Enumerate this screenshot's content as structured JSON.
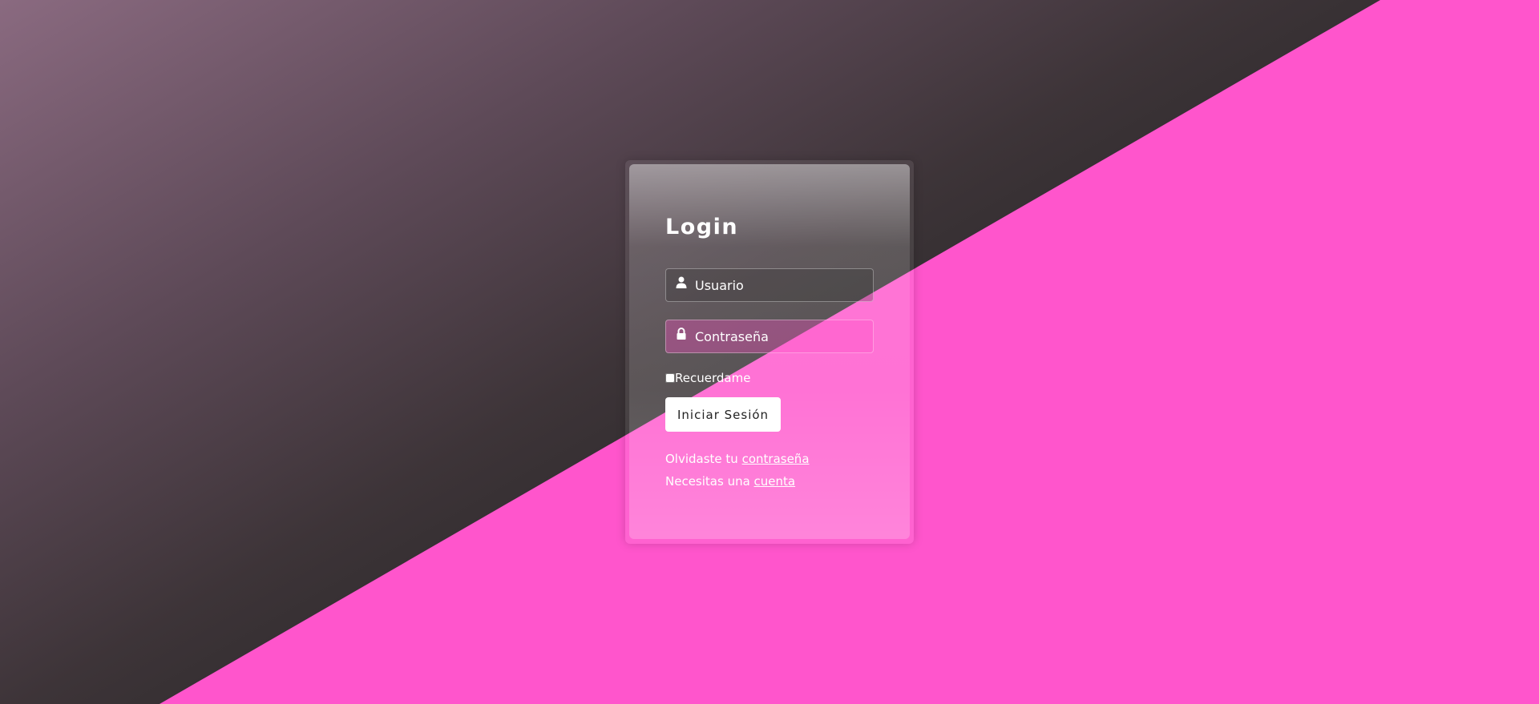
{
  "colors": {
    "accent_pink": "#ff55cc",
    "dark_background": "#262626",
    "text": "#ffffff"
  },
  "login": {
    "title": "Login",
    "username_placeholder": "Usuario",
    "username_icon": "user-icon",
    "password_placeholder": "Contraseña",
    "password_icon": "lock-icon",
    "remember_label": "Recuerdame",
    "remember_checked": false,
    "submit_label": "Iniciar Sesión",
    "forgot_prefix": "Olvidaste tu ",
    "forgot_link": "contraseña",
    "signup_prefix": "Necesitas una ",
    "signup_link": "cuenta"
  }
}
